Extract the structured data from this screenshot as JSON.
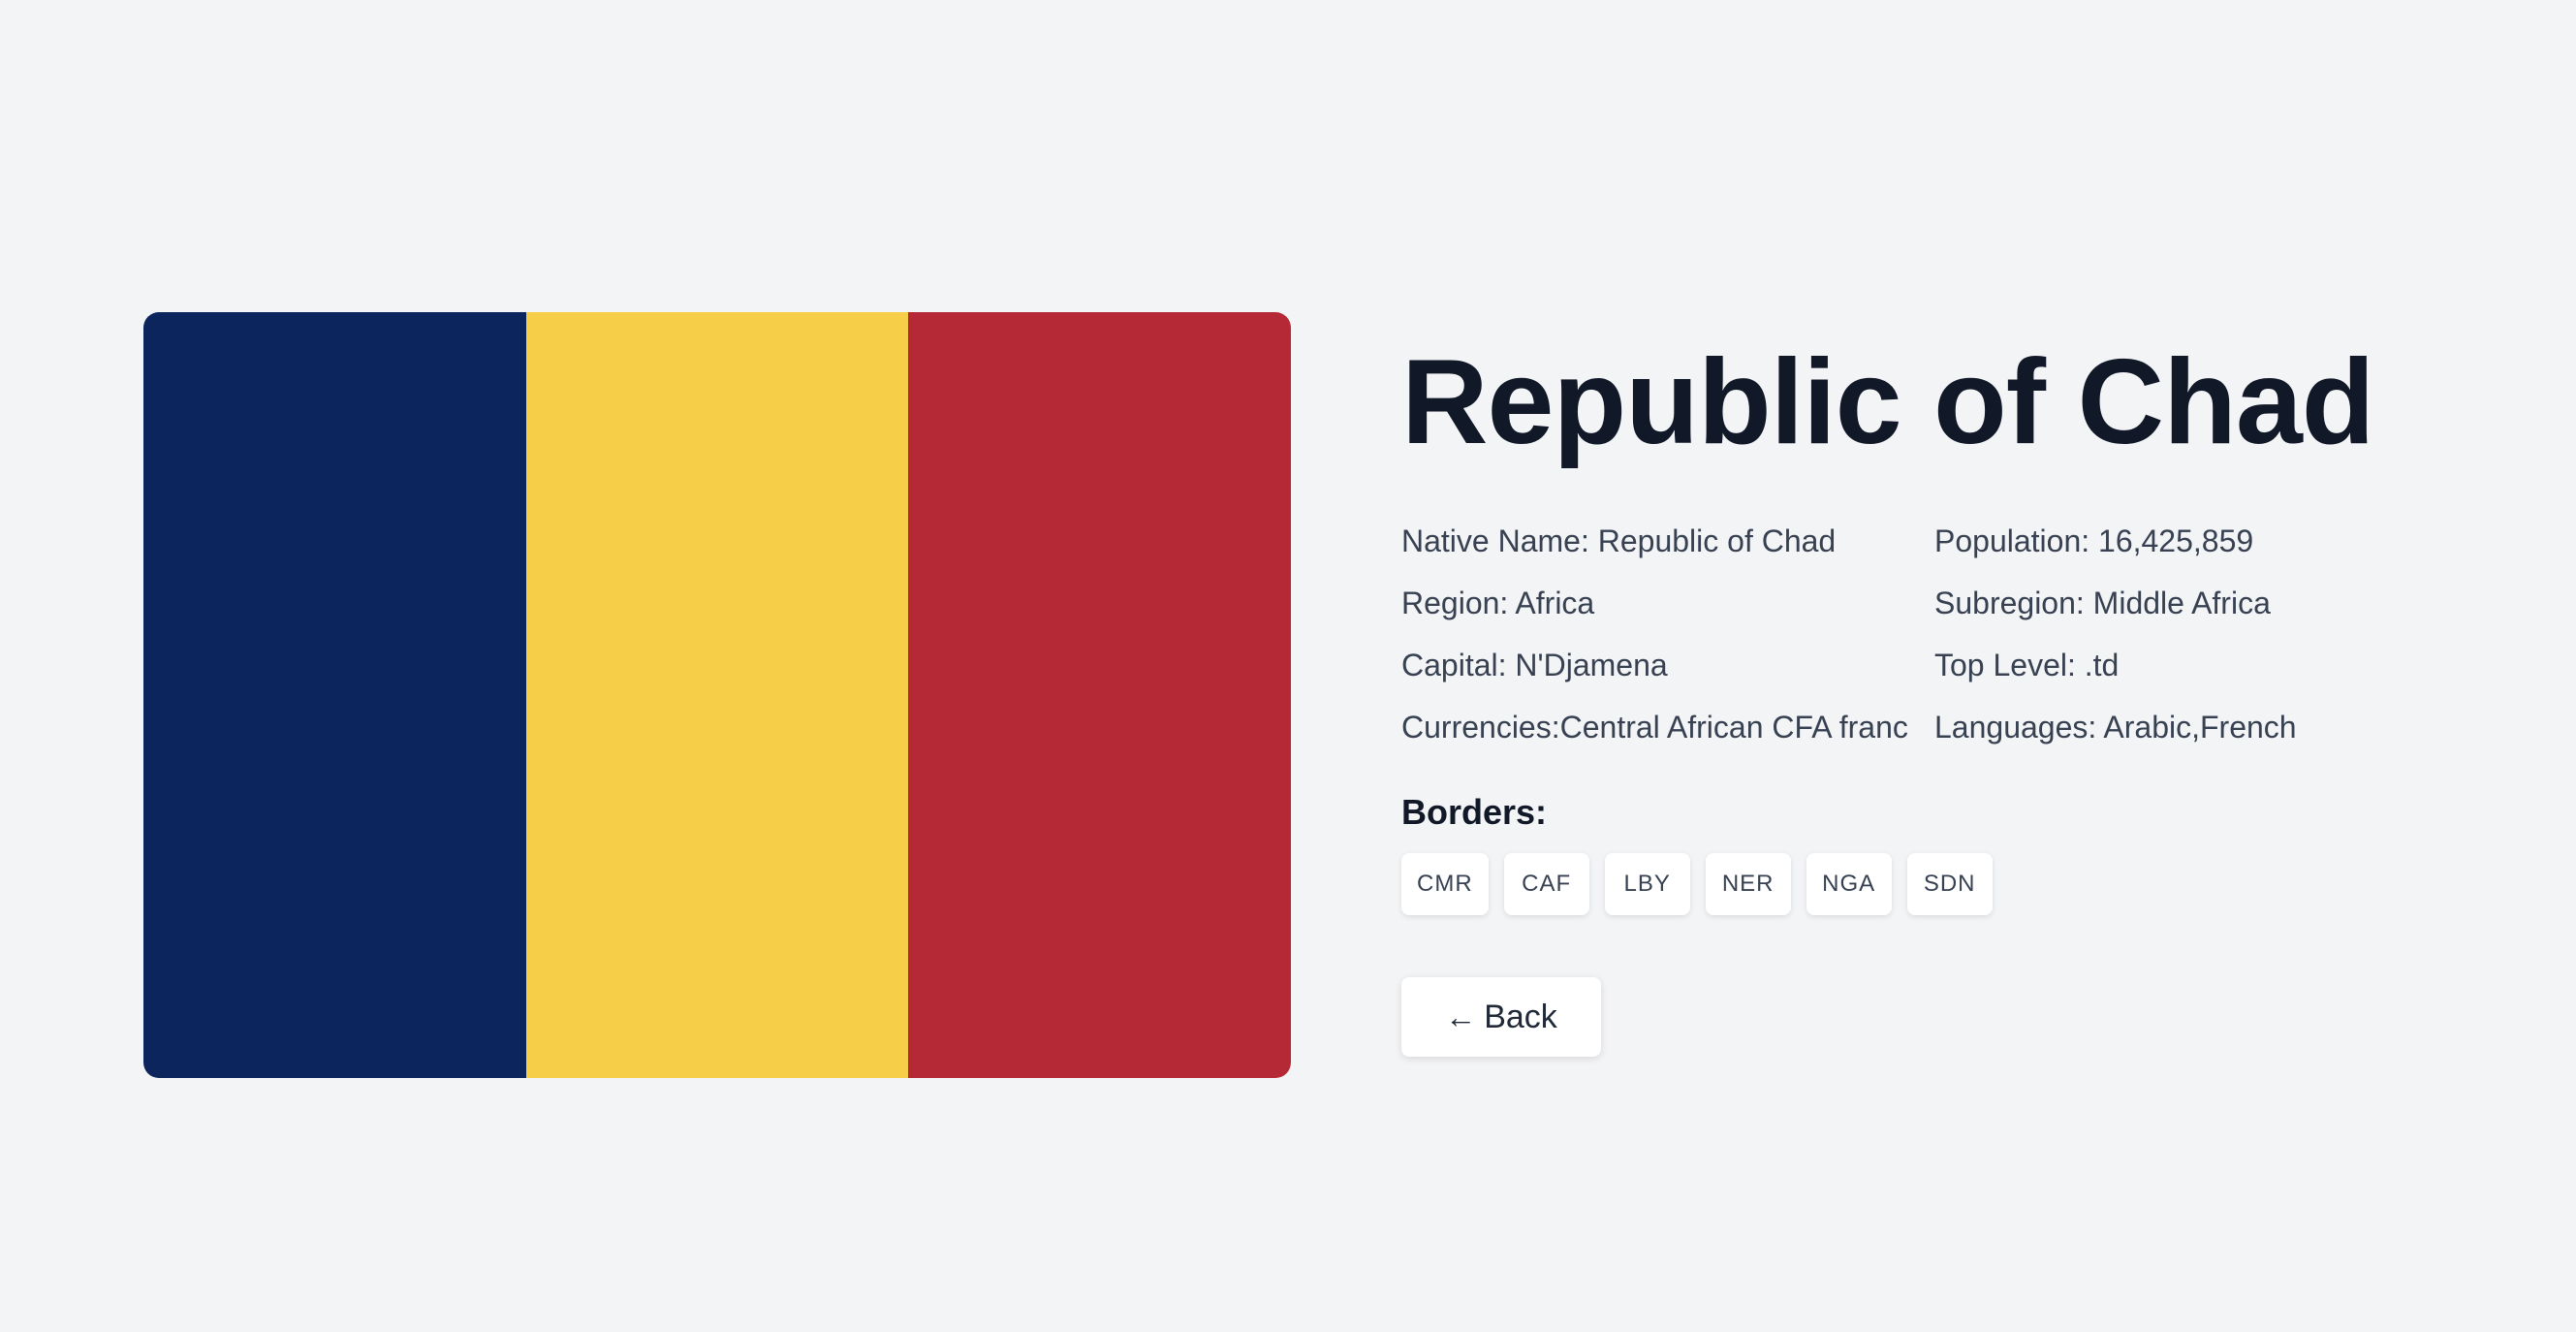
{
  "country": {
    "name": "Republic of Chad",
    "flag": {
      "stripes": [
        {
          "name": "blue",
          "color": "#0c255c"
        },
        {
          "name": "yellow",
          "color": "#f7ce47"
        },
        {
          "name": "red",
          "color": "#b52836"
        }
      ]
    },
    "details": {
      "native_name": "Native Name: Republic of Chad",
      "population": "Population: 16,425,859",
      "region": "Region: Africa",
      "subregion": "Subregion: Middle Africa",
      "capital": "Capital: N'Djamena",
      "top_level": "Top Level: .td",
      "currencies": "Currencies:Central African CFA franc",
      "languages": "Languages: Arabic,French"
    },
    "borders_label": "Borders:",
    "borders": [
      "CMR",
      "CAF",
      "LBY",
      "NER",
      "NGA",
      "SDN"
    ]
  },
  "back_button": {
    "icon": "arrow-left-icon",
    "icon_glyph": "←",
    "label": "Back"
  }
}
